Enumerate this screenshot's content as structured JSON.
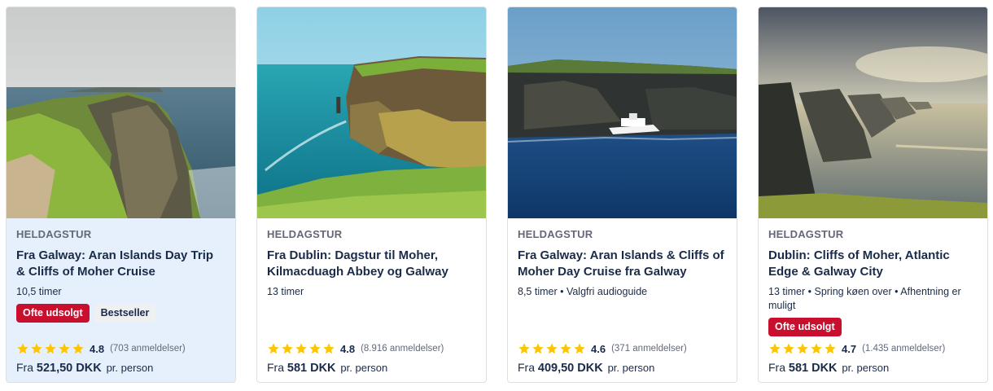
{
  "cards": [
    {
      "category": "HELDAGSTUR",
      "title": "Fra Galway: Aran Islands Day Trip & Cliffs of Moher Cruise",
      "meta": "10,5 timer",
      "badge_red": "Ofte udsolgt",
      "badge_grey": "Bestseller",
      "rating": "4.8",
      "reviews": "(703 anmeldelser)",
      "price_prefix": "Fra",
      "price": "521,50 DKK",
      "price_unit": "pr. person"
    },
    {
      "category": "HELDAGSTUR",
      "title": "Fra Dublin: Dagstur til Moher, Kilmacduagh Abbey og Galway",
      "meta": "13 timer",
      "rating": "4.8",
      "reviews": "(8.916 anmeldelser)",
      "price_prefix": "Fra",
      "price": "581 DKK",
      "price_unit": "pr. person"
    },
    {
      "category": "HELDAGSTUR",
      "title": "Fra Galway: Aran Islands & Cliffs of Moher Day Cruise fra Galway",
      "meta": "8,5 timer • Valgfri audioguide",
      "rating": "4.6",
      "reviews": "(371 anmeldelser)",
      "price_prefix": "Fra",
      "price": "409,50 DKK",
      "price_unit": "pr. person"
    },
    {
      "category": "HELDAGSTUR",
      "title": "Dublin: Cliffs of Moher, Atlantic Edge & Galway City",
      "meta": "13 timer • Spring køen over • Afhentning er muligt",
      "badge_red": "Ofte udsolgt",
      "rating": "4.7",
      "reviews": "(1.435 anmeldelser)",
      "price_prefix": "Fra",
      "price": "581 DKK",
      "price_unit": "pr. person"
    }
  ],
  "star_icon": "star-icon",
  "colors": {
    "star": "#fdc601",
    "badge_red": "#c8102e",
    "highlight_card": "#e6f0fd",
    "text": "#1a2b49",
    "muted": "#63687a"
  }
}
